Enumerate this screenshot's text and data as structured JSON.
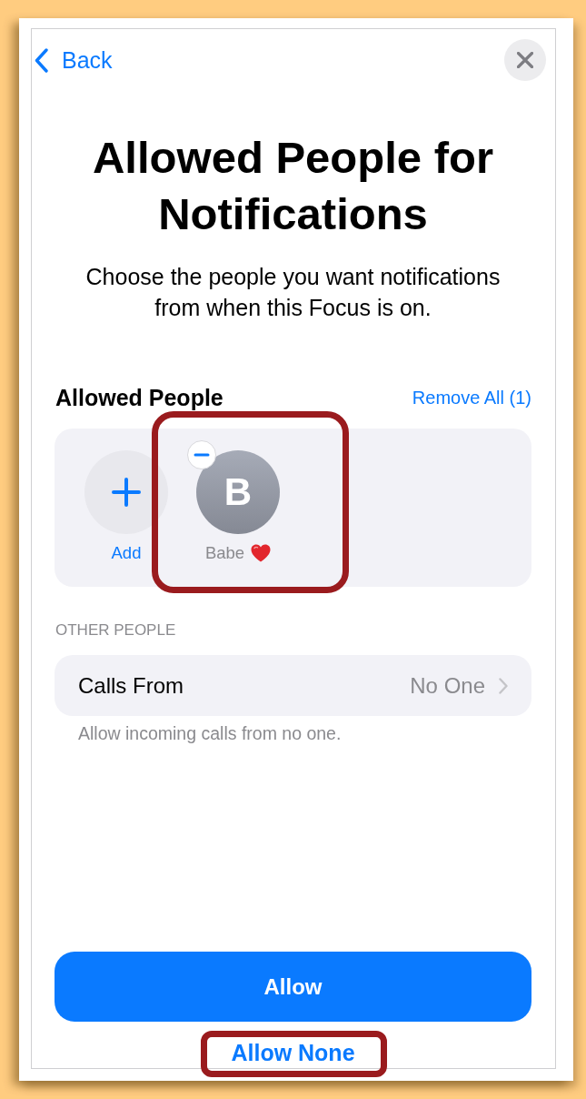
{
  "nav": {
    "back_label": "Back"
  },
  "title": "Allowed People for Notifications",
  "subtitle": "Choose the people you want notifications from when this Focus is on.",
  "allowed_people": {
    "heading": "Allowed People",
    "remove_all": "Remove All (1)",
    "add_label": "Add",
    "contacts": [
      {
        "initial": "B",
        "name": "Babe",
        "highlighted": true
      }
    ]
  },
  "other_people": {
    "heading": "OTHER PEOPLE",
    "rows": [
      {
        "label": "Calls From",
        "value": "No One"
      }
    ],
    "footnote": "Allow incoming calls from no one."
  },
  "buttons": {
    "primary": "Allow",
    "secondary": {
      "label": "Allow None",
      "highlighted": true
    }
  }
}
